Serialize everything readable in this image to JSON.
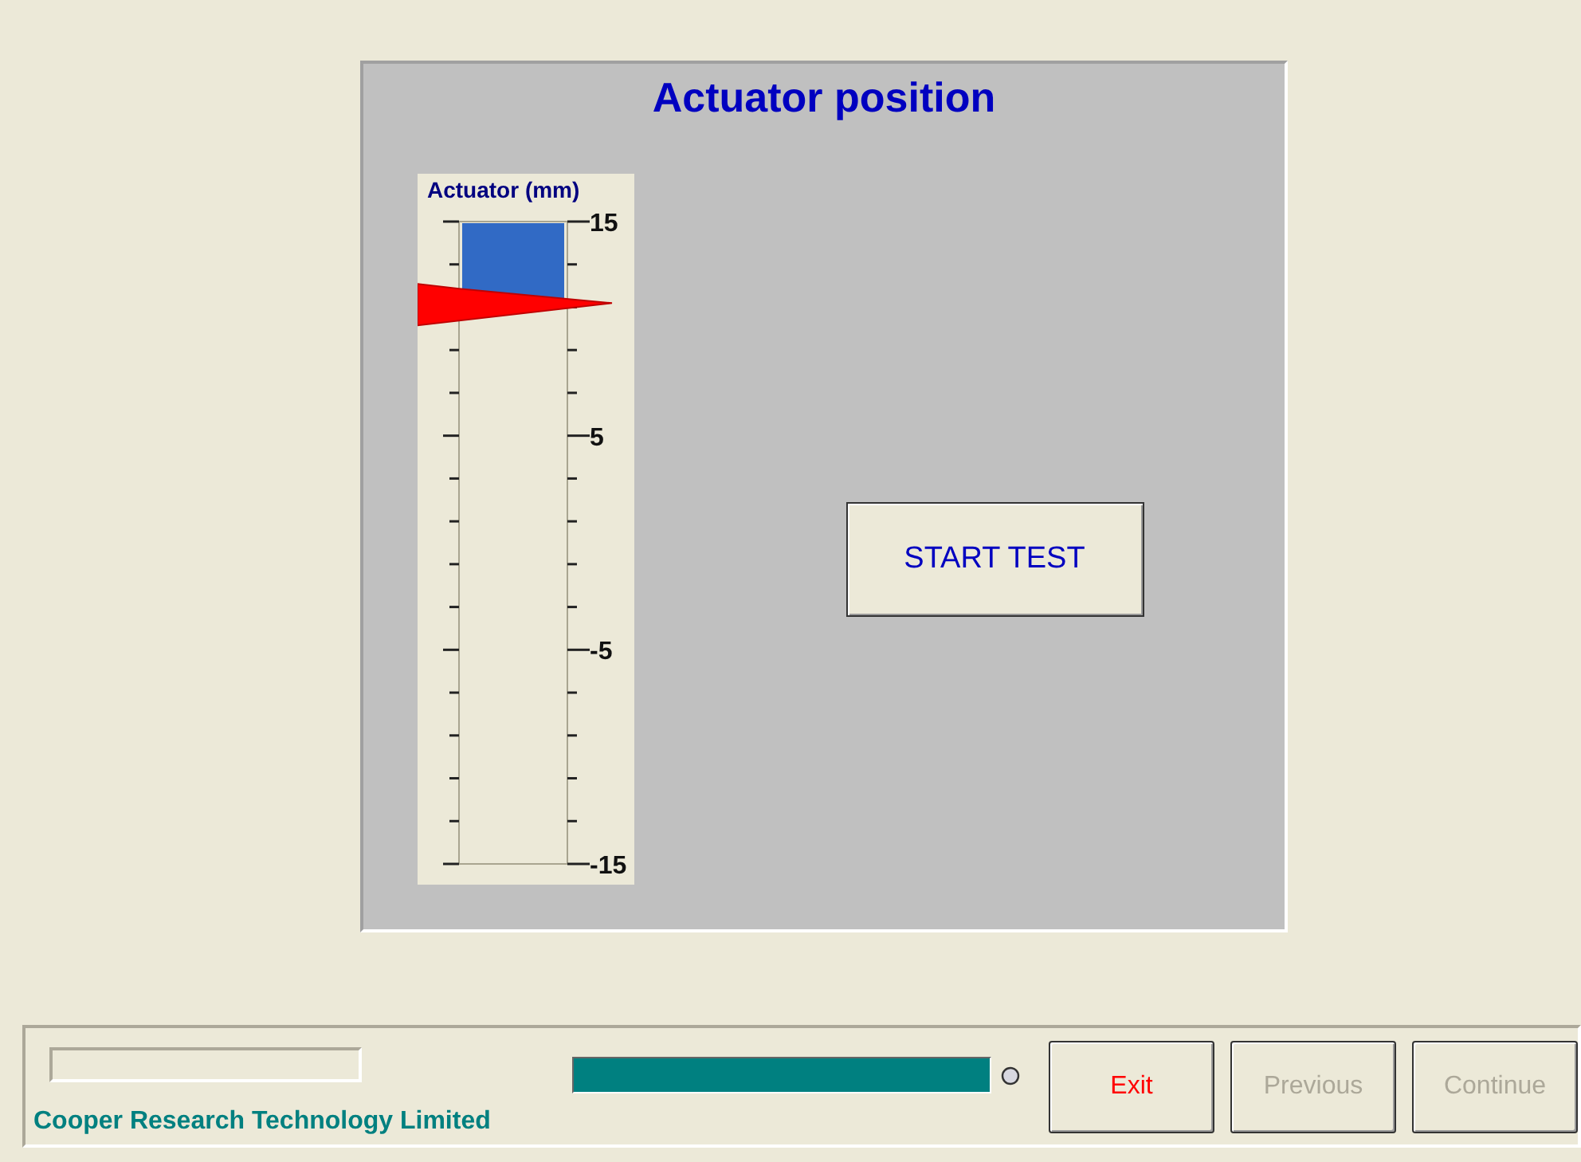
{
  "panel": {
    "title": "Actuator position"
  },
  "gauge": {
    "title": "Actuator (mm)",
    "level": 0.127,
    "scale_labels": [
      "15",
      "5",
      "-5",
      "-15"
    ]
  },
  "start_button": {
    "label": "START TEST"
  },
  "footer": {
    "company": "Cooper Research Technology Limited",
    "progress": {
      "level": 1
    },
    "buttons": [
      {
        "label": "Exit",
        "kind": "exit",
        "disabled": false
      },
      {
        "label": "Previous",
        "kind": "nav",
        "disabled": true
      },
      {
        "label": "Continue",
        "kind": "nav",
        "disabled": true
      }
    ]
  }
}
